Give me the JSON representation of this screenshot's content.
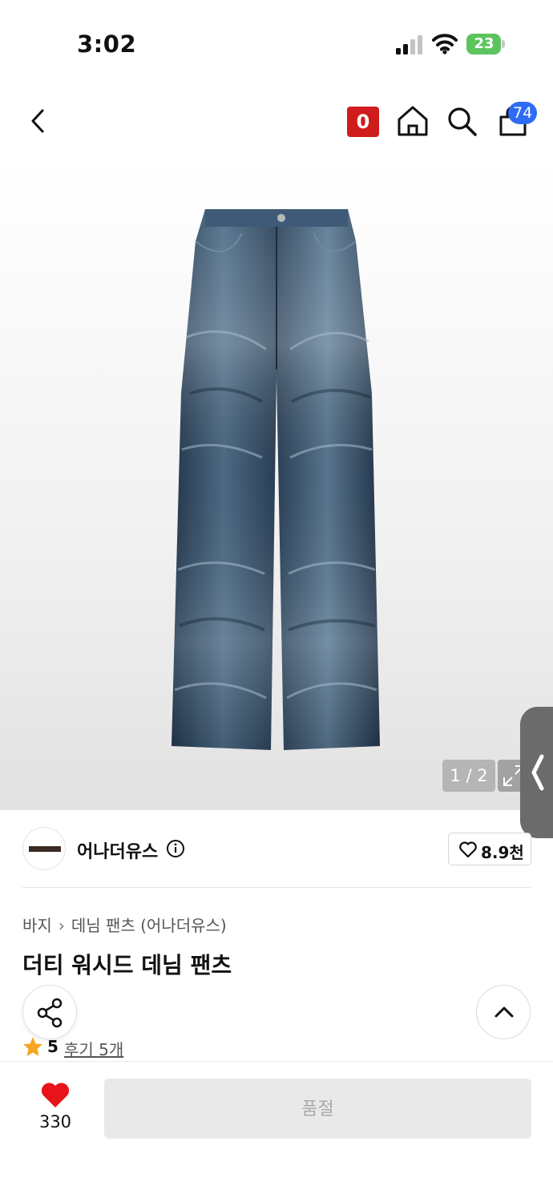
{
  "status_bar": {
    "time": "3:02",
    "battery": "23"
  },
  "header": {
    "badge": "0",
    "cart_count": "74"
  },
  "gallery": {
    "counter": "1 / 2"
  },
  "brand": {
    "name": "어나더유스",
    "likes": "8.9천"
  },
  "breadcrumb": {
    "category": "바지",
    "subcategory": "데님 팬츠 (어나더유스)"
  },
  "product": {
    "title": "더티 워시드 데님 팬츠",
    "rating": "5",
    "reviews": "후기 5개"
  },
  "bottom_bar": {
    "wish_count": "330",
    "action_label": "품절"
  },
  "colors": {
    "accent_red": "#d01c1c",
    "cart_badge": "#2f6cf5",
    "heart": "#e8141b",
    "star": "#f5a623"
  }
}
